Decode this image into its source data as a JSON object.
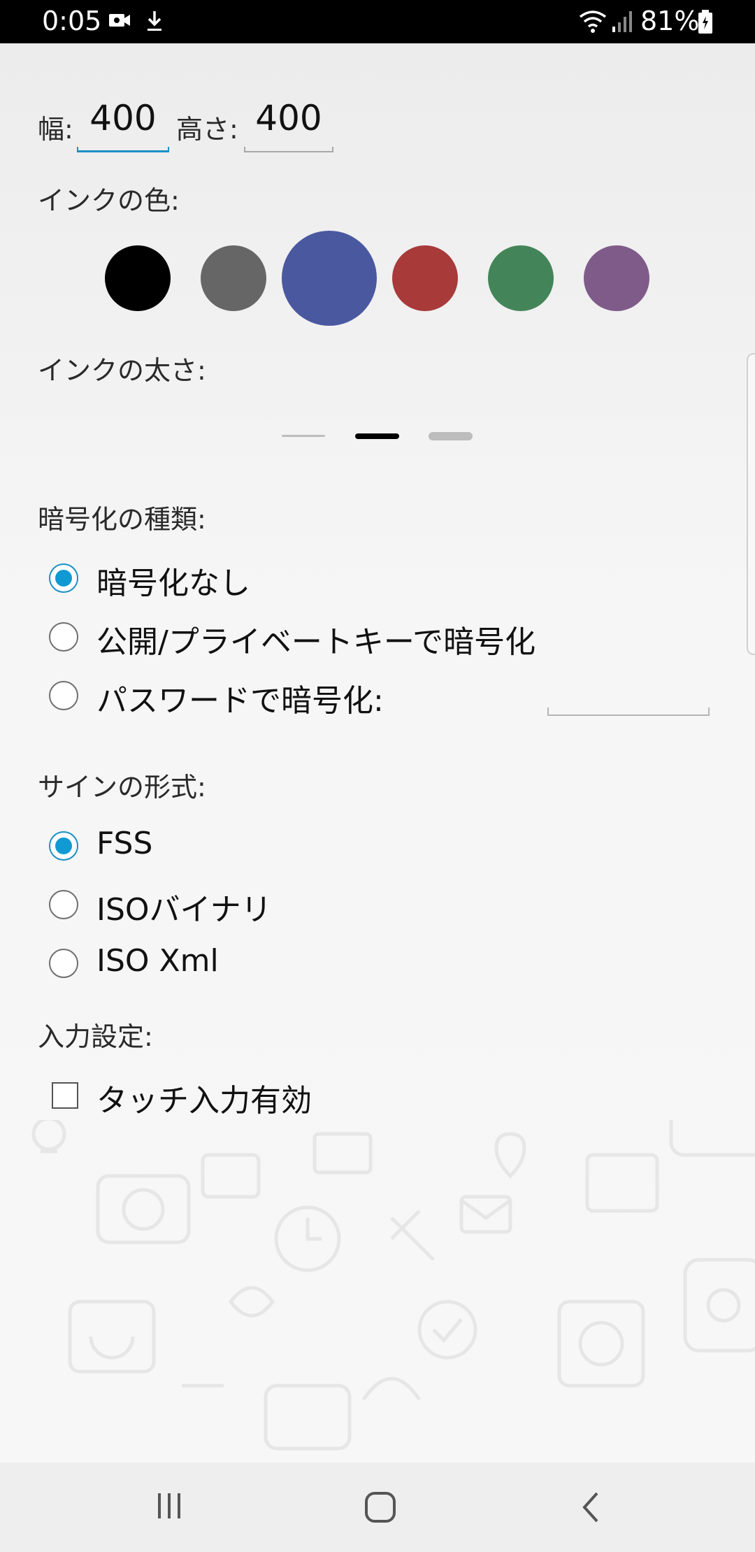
{
  "status": {
    "time": "0:05",
    "battery": "81%"
  },
  "size": {
    "width_label": "幅:",
    "width_value": "400",
    "height_label": "高さ:",
    "height_value": "400"
  },
  "ink_color": {
    "label": "インクの色:",
    "swatches": [
      "#000000",
      "#666666",
      "#4a58a0",
      "#a83a3a",
      "#438559",
      "#7f5b8a"
    ],
    "selected_index": 2
  },
  "ink_width": {
    "label": "インクの太さ:",
    "options": [
      "thin",
      "medium",
      "thick"
    ],
    "selected_index": 1
  },
  "encryption": {
    "label": "暗号化の種類:",
    "options": [
      "暗号化なし",
      "公開/プライベートキーで暗号化",
      "パスワードで暗号化:"
    ],
    "selected_index": 0,
    "password_value": ""
  },
  "sign_format": {
    "label": "サインの形式:",
    "options": [
      "FSS",
      "ISOバイナリ",
      "ISO Xml"
    ],
    "selected_index": 0
  },
  "input_settings": {
    "label": "入力設定:",
    "touch_input_label": "タッチ入力有効",
    "touch_input_checked": false
  },
  "accent_color": "#1b90c5",
  "nav": {
    "recent": "recent-apps-icon",
    "home": "home-icon",
    "back": "back-icon"
  }
}
